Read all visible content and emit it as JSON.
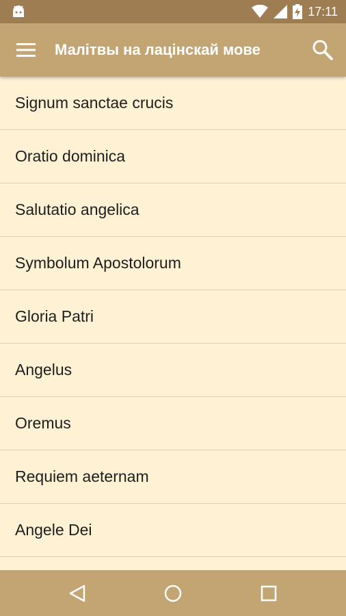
{
  "status_bar": {
    "time": "17:11",
    "icons": [
      "android-icon",
      "wifi-icon",
      "signal-icon",
      "battery-charging-icon"
    ]
  },
  "app_bar": {
    "title": "Малітвы на лацінскай мове",
    "menu_icon": "hamburger-menu-icon",
    "search_icon": "search-icon"
  },
  "prayers": [
    "Signum sanctae crucis",
    "Oratio dominica",
    "Salutatio angelica",
    "Symbolum Apostolorum",
    "Gloria Patri",
    "Angelus",
    "Oremus",
    "Requiem aeternam",
    "Angele Dei"
  ],
  "nav_bar": {
    "icons": [
      "back-icon",
      "home-icon",
      "recents-icon"
    ]
  },
  "colors": {
    "status_bar": "#9E7D52",
    "app_bar": "#C2A572",
    "background": "#FFF1D4",
    "divider": "#DCCFB5",
    "text": "#1E1E1E"
  }
}
